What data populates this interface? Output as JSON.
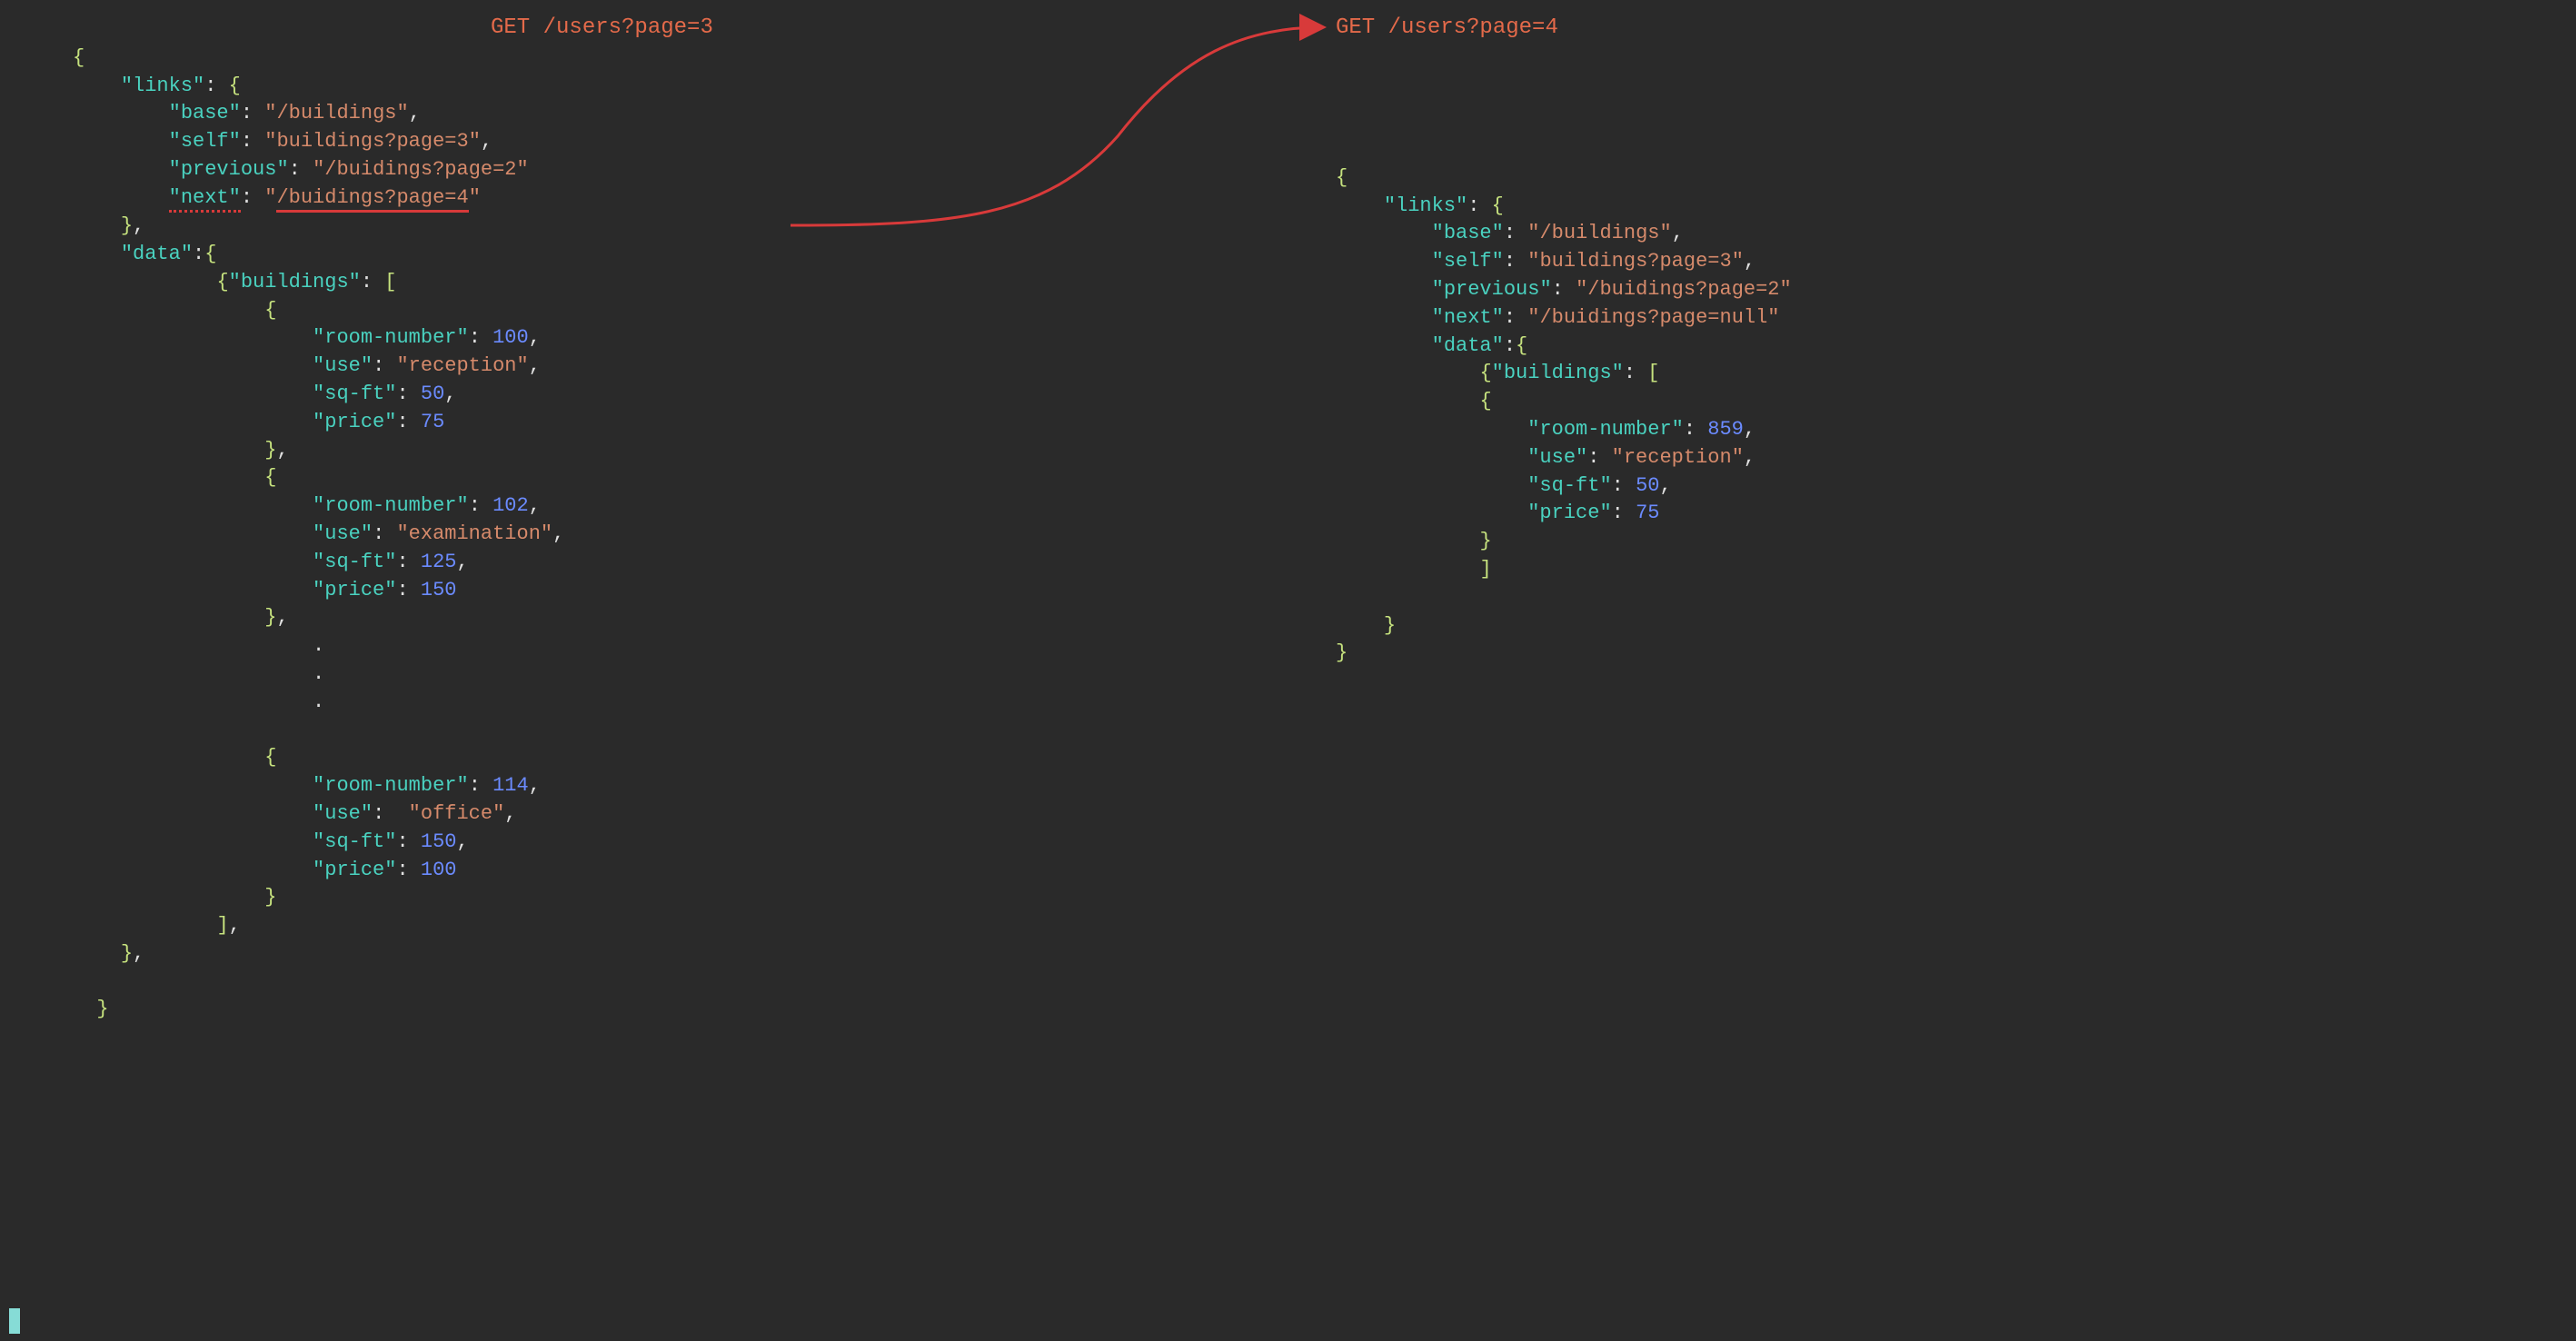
{
  "labels": {
    "left": "GET /users?page=3",
    "right": "GET /users?page=4"
  },
  "left": {
    "links": {
      "base": "/buildings",
      "self": "buildings?page=3",
      "previous": "/buidings?page=2",
      "next": "/buidings?page=4"
    },
    "buildings": [
      {
        "room_number": 100,
        "use": "reception",
        "sq_ft": 50,
        "price": 75
      },
      {
        "room_number": 102,
        "use": "examination",
        "sq_ft": 125,
        "price": 150
      },
      {
        "room_number": 114,
        "use": "office",
        "sq_ft": 150,
        "price": 100
      }
    ]
  },
  "right": {
    "links": {
      "base": "/buildings",
      "self": "buildings?page=3",
      "previous": "/buidings?page=2",
      "next": "/buidings?page=null"
    },
    "buildings": [
      {
        "room_number": 859,
        "use": "reception",
        "sq_ft": 50,
        "price": 75
      }
    ]
  }
}
